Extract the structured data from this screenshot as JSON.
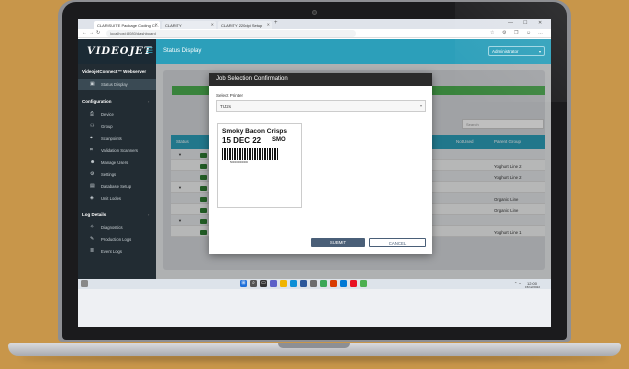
{
  "browser": {
    "tabs": [
      {
        "label": "CLARiSUITE Package Coding Cl..."
      },
      {
        "label": "CLARiTY"
      },
      {
        "label": "CLARiTY 220dpi Setup"
      }
    ],
    "new_tab": "+",
    "url": "localhost:8080/dashboard",
    "win_min": "—",
    "win_max": "☐",
    "win_close": "✕"
  },
  "app": {
    "logo": "VIDEOJET",
    "page_title": "Status Display",
    "user_select": "Administrator"
  },
  "sidebar": {
    "title": "VideojetConnect™ Webserver",
    "status_display": "Status Display",
    "configuration_heading": "Configuration",
    "config_items": [
      {
        "label": "Device",
        "icon": "printer-icon"
      },
      {
        "label": "Group",
        "icon": "group-icon"
      },
      {
        "label": "Scanpoints",
        "icon": "scan-icon"
      },
      {
        "label": "Validation Scanners",
        "icon": "barcode-icon"
      },
      {
        "label": "Manage Users",
        "icon": "users-icon"
      },
      {
        "label": "Settings",
        "icon": "settings-icon"
      },
      {
        "label": "Database Setup",
        "icon": "database-icon"
      },
      {
        "label": "Unit Lodes",
        "icon": "unit-icon"
      }
    ],
    "log_heading": "Log Details",
    "log_items": [
      {
        "label": "Diagnostics",
        "icon": "diagnostics-icon"
      },
      {
        "label": "Production Logs",
        "icon": "logs-icon"
      },
      {
        "label": "Event Logs",
        "icon": "event-icon"
      }
    ]
  },
  "table": {
    "search_placeholder": "Search",
    "headers": {
      "status": "Status",
      "notused": "NotUsed",
      "parent": "Parent Group"
    },
    "rows": [
      {
        "parent": "Yoghurt Line 2"
      },
      {
        "parent": "Yoghurt Line 2"
      },
      {
        "parent": "Organic Line"
      },
      {
        "parent": "Organic Line"
      },
      {
        "parent": "Yoghurt Line 1"
      }
    ]
  },
  "modal": {
    "title": "Job Selection Confirmation",
    "select_label": "Select Printer",
    "select_value": "TIJ2s",
    "preview": {
      "line1": "Smoky Bacon Crisps",
      "date": "15 DEC 22",
      "code": "SMO",
      "barcode_number": "5000000000000"
    },
    "submit": "SUBMIT",
    "cancel": "CANCEL"
  },
  "taskbar": {
    "clock_time": "12:00",
    "clock_date": "15/12/2022"
  }
}
